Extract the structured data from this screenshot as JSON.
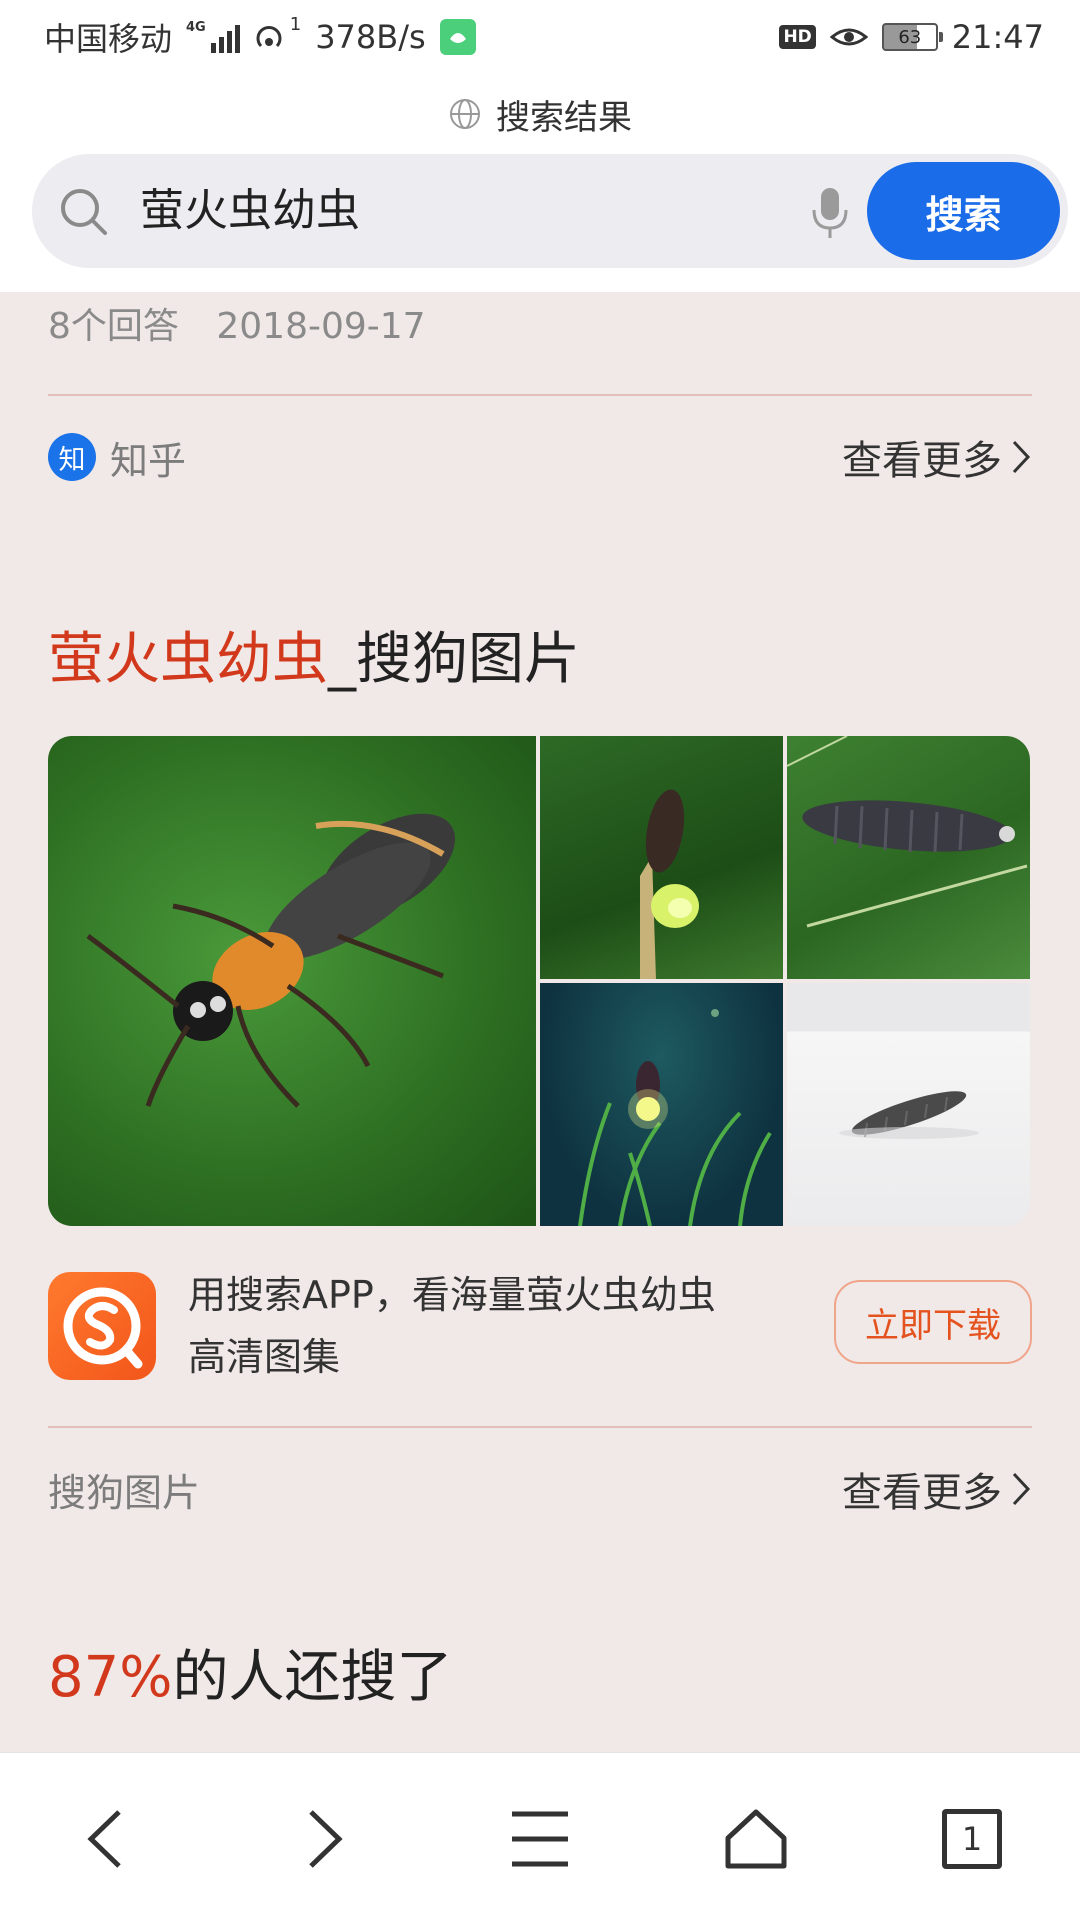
{
  "status_bar": {
    "carrier": "中国移动",
    "network_type": "4G",
    "hotspot_count": "1",
    "speed": "378B/s",
    "hd_label": "HD",
    "battery": "63",
    "time": "21:47"
  },
  "header": {
    "title": "搜索结果",
    "search": {
      "query": "萤火虫幼虫",
      "button_label": "搜索"
    }
  },
  "zhihu_result": {
    "answers": "8个回答",
    "date": "2018-09-17",
    "source": "知乎",
    "source_icon_char": "知",
    "see_more": "查看更多"
  },
  "image_section": {
    "title_highlight": "萤火虫幼虫",
    "title_rest": "_搜狗图片",
    "images": [
      {
        "icon": "firefly-on-leaf"
      },
      {
        "icon": "firefly-on-stem-glowing"
      },
      {
        "icon": "larva-on-leaf"
      },
      {
        "icon": "firefly-in-grass"
      },
      {
        "icon": "larva-on-white"
      }
    ],
    "promo_line1": "用搜索APP，看海量萤火虫幼虫",
    "promo_line2": "高清图集",
    "download_label": "立即下载",
    "source": "搜狗图片",
    "see_more": "查看更多"
  },
  "related": {
    "percent": "87%",
    "text": "的人还搜了"
  },
  "bottom_nav": {
    "tab_count": "1"
  },
  "colors": {
    "accent_blue": "#1a6ce8",
    "highlight_red": "#d2391c",
    "sogou_orange": "#f2551a",
    "background": "#f1e9e7"
  }
}
